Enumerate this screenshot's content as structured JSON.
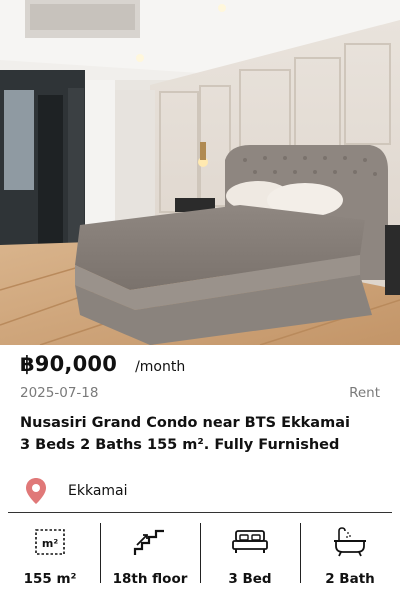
{
  "listing": {
    "price": "฿90,000",
    "period": "/month",
    "date": "2025-07-18",
    "type": "Rent",
    "title_line1": "Nusasiri Grand Condo near BTS Ekkamai",
    "title_line2": "3 Beds 2 Baths 155 m². Fully Furnished",
    "location": "Ekkamai",
    "location_icon": "map-pin-icon",
    "accent_color": "#e07878"
  },
  "features": [
    {
      "icon": "area-icon",
      "icon_text": "m²",
      "label": "155 m²"
    },
    {
      "icon": "stairs-icon",
      "label": "18th floor"
    },
    {
      "icon": "bed-icon",
      "label": "3 Bed"
    },
    {
      "icon": "bathtub-icon",
      "label": "2 Bath"
    }
  ]
}
